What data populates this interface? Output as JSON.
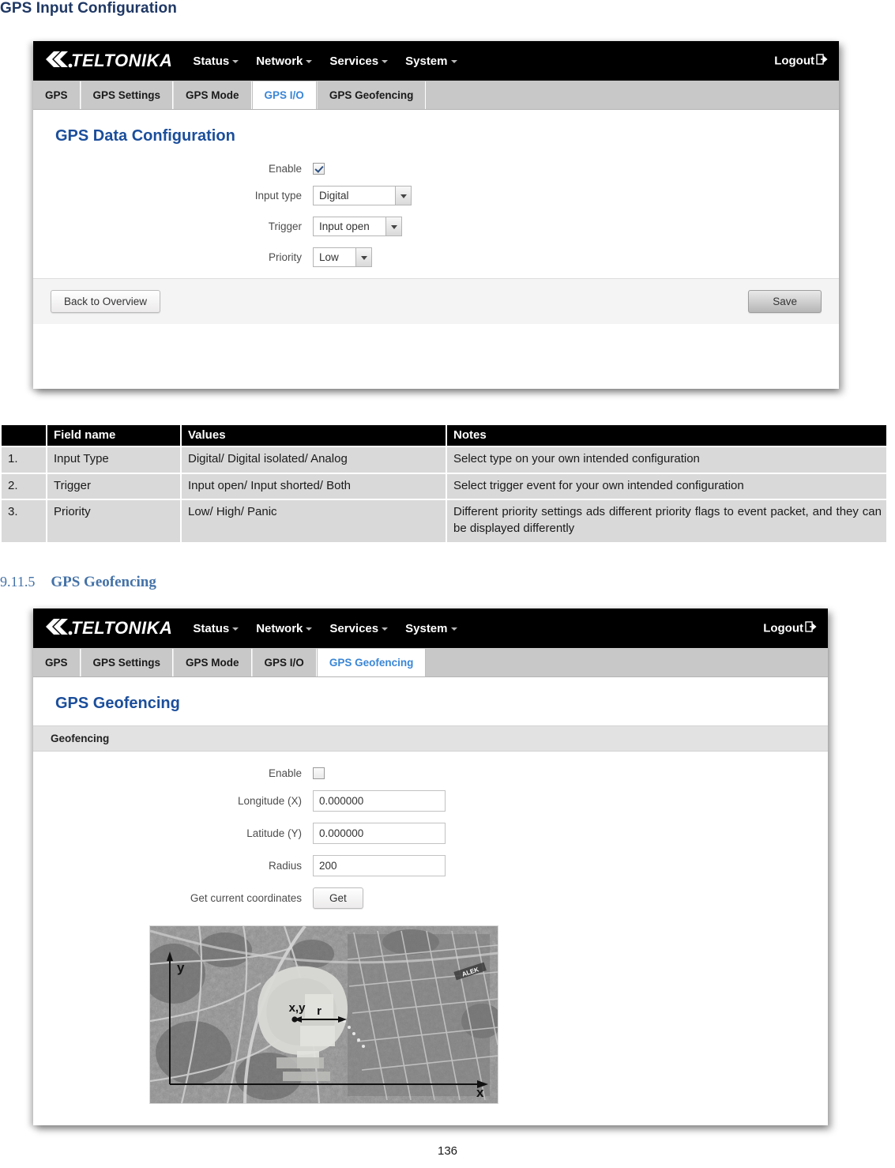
{
  "document": {
    "heading_gps_input": "GPS Input Configuration",
    "section_number": "9.11.5",
    "section_title": "GPS Geofencing",
    "page_number": "136"
  },
  "router_ui": {
    "brand": "TELTONIKA",
    "nav": [
      {
        "label": "Status",
        "icon": "chevron-down-icon"
      },
      {
        "label": "Network",
        "icon": "chevron-down-icon"
      },
      {
        "label": "Services",
        "icon": "chevron-down-icon"
      },
      {
        "label": "System",
        "icon": "chevron-down-icon"
      }
    ],
    "logout_label": "Logout",
    "logout_icon": "logout-arrow-icon"
  },
  "screenshot_gps_io": {
    "tabs": [
      {
        "label": "GPS",
        "active": false
      },
      {
        "label": "GPS Settings",
        "active": false
      },
      {
        "label": "GPS Mode",
        "active": false
      },
      {
        "label": "GPS I/O",
        "active": true
      },
      {
        "label": "GPS Geofencing",
        "active": false
      }
    ],
    "panel_title": "GPS Data Configuration",
    "fields": {
      "enable_label": "Enable",
      "enable_checked": true,
      "input_type_label": "Input type",
      "input_type_value": "Digital",
      "trigger_label": "Trigger",
      "trigger_value": "Input open",
      "priority_label": "Priority",
      "priority_value": "Low"
    },
    "buttons": {
      "back_label": "Back to Overview",
      "save_label": "Save"
    }
  },
  "screenshot_geofencing": {
    "tabs": [
      {
        "label": "GPS",
        "active": false
      },
      {
        "label": "GPS Settings",
        "active": false
      },
      {
        "label": "GPS Mode",
        "active": false
      },
      {
        "label": "GPS I/O",
        "active": false
      },
      {
        "label": "GPS Geofencing",
        "active": true
      }
    ],
    "panel_title": "GPS Geofencing",
    "section_bar_label": "Geofencing",
    "fields": {
      "enable_label": "Enable",
      "enable_checked": false,
      "longitude_label": "Longitude (X)",
      "longitude_value": "0.000000",
      "latitude_label": "Latitude (Y)",
      "latitude_value": "0.000000",
      "radius_label": "Radius",
      "radius_value": "200",
      "get_coords_label": "Get current coordinates",
      "get_button_label": "Get"
    },
    "map_figure": {
      "alt": "Grayscale aerial map with geofence circle",
      "labels": {
        "y_axis": "y",
        "x_axis": "x",
        "center": "x,y",
        "radius": "r",
        "street": "ALEK"
      }
    }
  },
  "reference_table": {
    "headers": [
      "",
      "Field name",
      "Values",
      "Notes"
    ],
    "rows": [
      {
        "num": "1.",
        "field": "Input Type",
        "values": "Digital/ Digital isolated/ Analog",
        "notes": "Select type on your own intended configuration"
      },
      {
        "num": "2.",
        "field": "Trigger",
        "values": "Input open/ Input shorted/ Both",
        "notes": "Select trigger event for your own intended configuration"
      },
      {
        "num": "3.",
        "field": "Priority",
        "values": "Low/ High/ Panic",
        "notes": "Different priority settings ads different priority flags to event packet, and they can be displayed differently"
      }
    ]
  },
  "colors": {
    "heading_blue": "#1f3864",
    "section_blue": "#4472a8",
    "panel_title_blue": "#1b4e9b",
    "active_tab_blue": "#3a86d6",
    "navbar_black": "#000000",
    "tab_gray": "#c8c8c8",
    "table_row_gray": "#d9d9d9"
  }
}
